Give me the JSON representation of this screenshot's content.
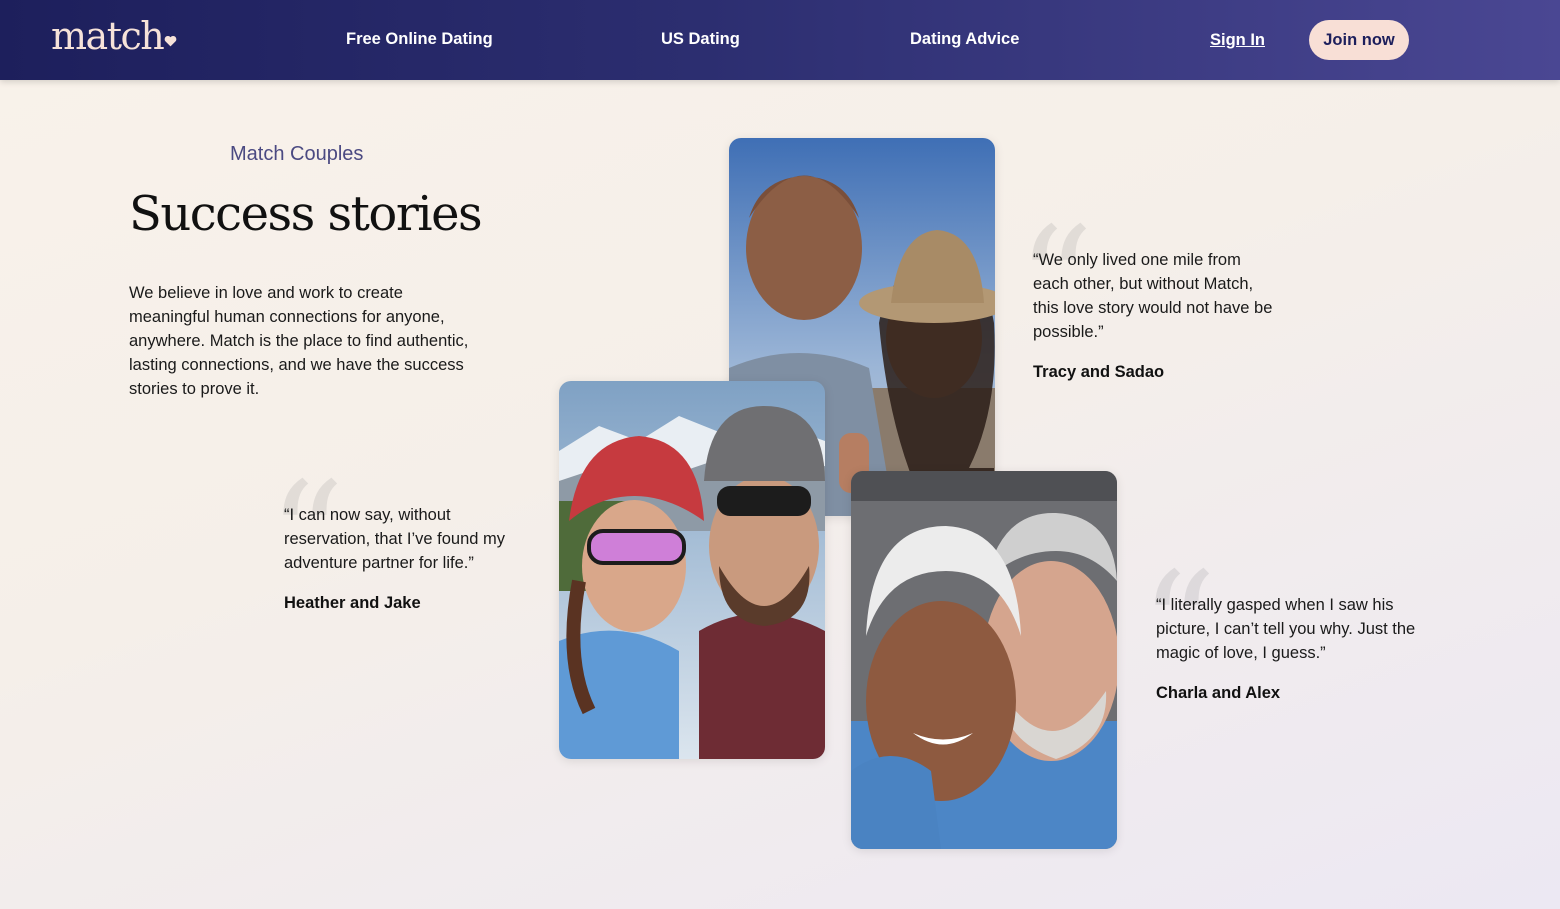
{
  "header": {
    "logo_text": "match",
    "logo_icon": "heart-icon",
    "nav": [
      {
        "label": "Free Online Dating"
      },
      {
        "label": "US Dating"
      },
      {
        "label": "Dating Advice"
      }
    ],
    "sign_in_label": "Sign In",
    "join_label": "Join now"
  },
  "intro": {
    "eyebrow": "Match Couples",
    "title": "Success stories",
    "body": "We believe in love and work to create meaningful human connections for anyone, anywhere. Match is the place to find authentic, lasting connections, and we have the success stories to prove it."
  },
  "stories": [
    {
      "quote": "“We only lived one mile from each other, but without Match, this love story would not have be possible.”",
      "names": "Tracy and Sadao"
    },
    {
      "quote": "“I can now say, without reservation, that I’ve found my adventure partner for life.”",
      "names": "Heather and Jake"
    },
    {
      "quote": "“I literally gasped when I saw his picture, I can’t tell you why. Just the magic of love, I guess.”",
      "names": "Charla and Alex"
    }
  ],
  "quote_glyph": "“",
  "colors": {
    "header_start": "#1d1f5c",
    "header_end": "#4a4793",
    "join_button_bg": "#f8dfd6",
    "join_button_text": "#1d1f5c",
    "eyebrow": "#4b4a82",
    "logo": "#f6e2d9"
  }
}
